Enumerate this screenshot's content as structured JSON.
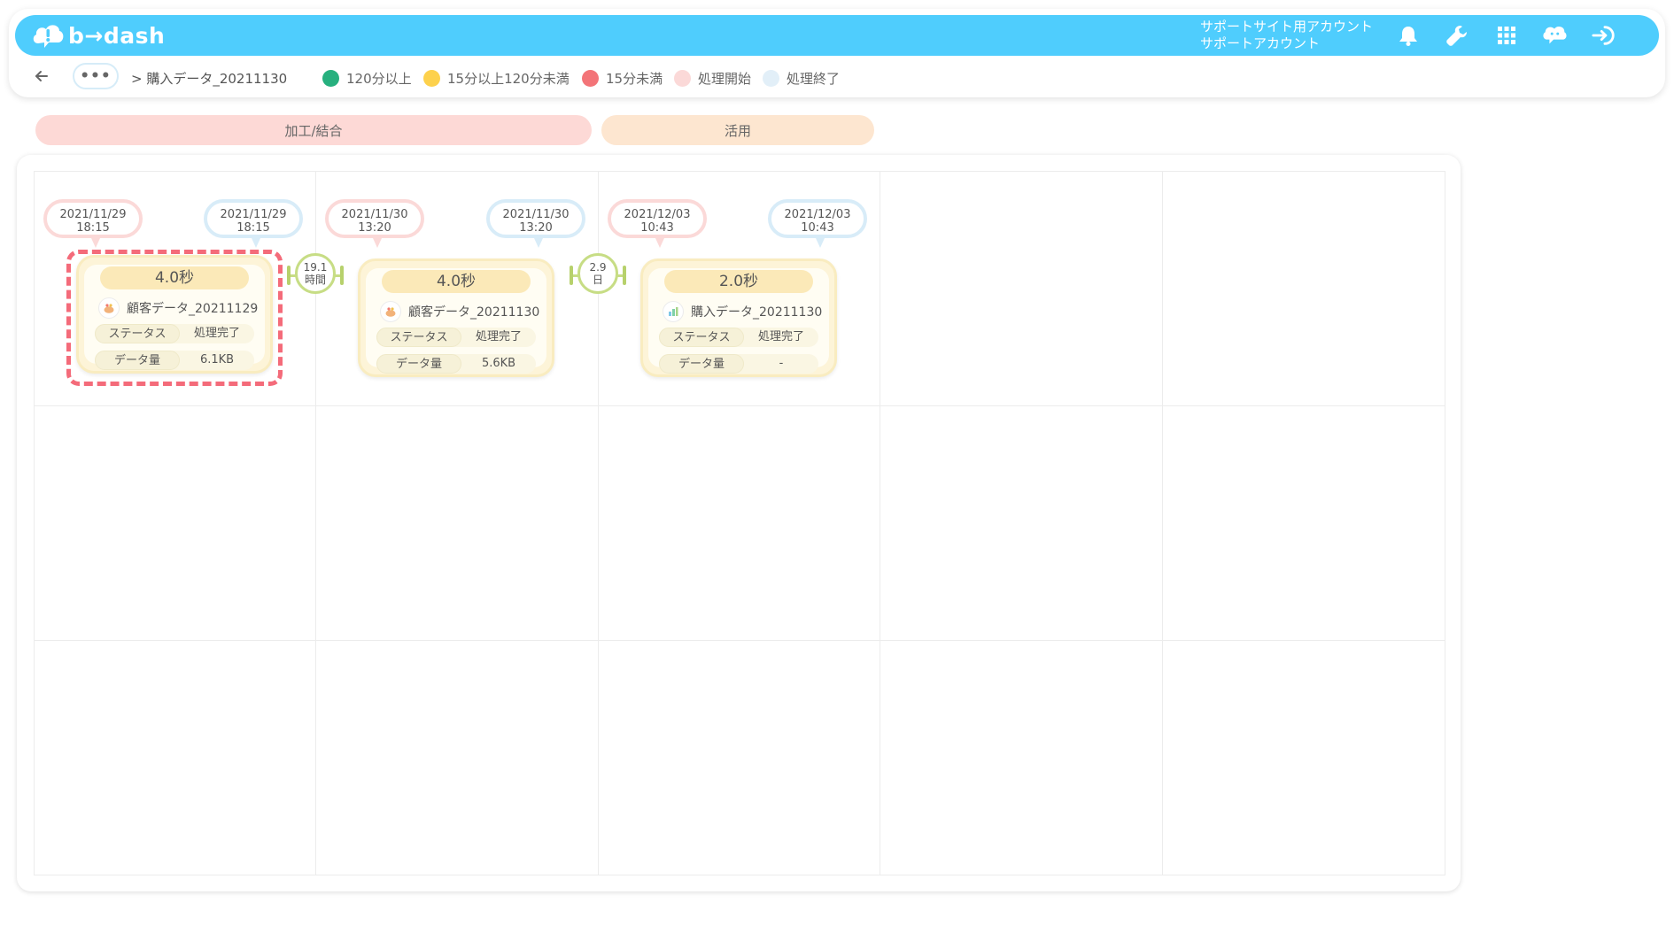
{
  "app": {
    "logo_text": "b→dash",
    "account_line1": "サポートサイト用アカウント",
    "account_line2": "サポートアカウント"
  },
  "header_icons": [
    "bell-icon",
    "wrench-icon",
    "grid-menu-icon",
    "chat-support-icon",
    "logout-icon"
  ],
  "breadcrumb": {
    "more": "•••",
    "current": "> 購入データ_20211130"
  },
  "legend": [
    {
      "label": "120分以上",
      "color": "#27b07e"
    },
    {
      "label": "15分以上120分未満",
      "color": "#fdd14c"
    },
    {
      "label": "15分未満",
      "color": "#f37478"
    },
    {
      "label": "処理開始",
      "color": "#fbd9d8"
    },
    {
      "label": "処理終了",
      "color": "#e2eff8"
    }
  ],
  "phases": [
    {
      "label": "加工/結合",
      "color": "#fdd9d6"
    },
    {
      "label": "活用",
      "color": "#fde6d0"
    }
  ],
  "nodes": [
    {
      "start": "2021/11/29\n18:15",
      "end": "2021/11/29\n18:15",
      "duration": "4.0秒",
      "name": "顧客データ_20211129",
      "status_label": "ステータス",
      "status_value": "処理完了",
      "size_label": "データ量",
      "size_value": "6.1KB"
    },
    {
      "start": "2021/11/30\n13:20",
      "end": "2021/11/30\n13:20",
      "duration": "4.0秒",
      "name": "顧客データ_20211130",
      "status_label": "ステータス",
      "status_value": "処理完了",
      "size_label": "データ量",
      "size_value": "5.6KB"
    },
    {
      "start": "2021/12/03\n10:43",
      "end": "2021/12/03\n10:43",
      "duration": "2.0秒",
      "name": "購入データ_20211130",
      "status_label": "ステータス",
      "status_value": "処理完了",
      "size_label": "データ量",
      "size_value": "-"
    }
  ],
  "intervals": [
    {
      "value": "19.1",
      "unit": "時間"
    },
    {
      "value": "2.9",
      "unit": "日"
    }
  ],
  "colors": {
    "topbar": "#4fcdfd",
    "selected_outline": "#f46b7a"
  }
}
